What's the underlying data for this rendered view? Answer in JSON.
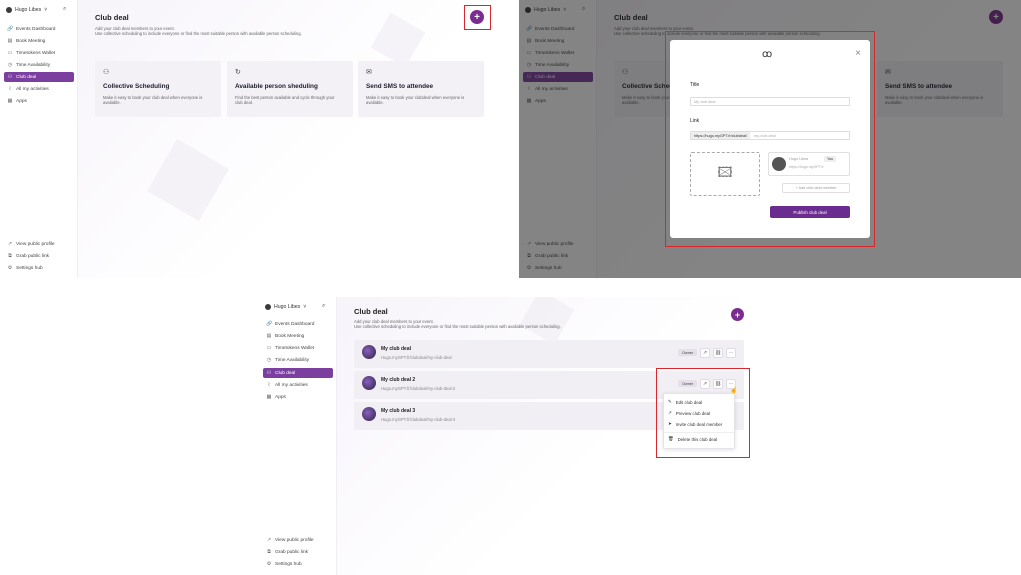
{
  "user": {
    "name": "Hugo Libes",
    "chevron": "˅"
  },
  "sidebar": {
    "items": [
      {
        "label": "Events Dashboard",
        "icon": "link-icon"
      },
      {
        "label": "Book Meeting",
        "icon": "calendar-icon"
      },
      {
        "label": "Timetokens Wallet",
        "icon": "wallet-icon"
      },
      {
        "label": "Time Availability",
        "icon": "clock-icon"
      },
      {
        "label": "Club deal",
        "icon": "users-icon"
      },
      {
        "label": "All my activities",
        "icon": "activity-icon"
      },
      {
        "label": "Apps",
        "icon": "grid-icon"
      }
    ],
    "bottom": [
      {
        "label": "View public profile",
        "icon": "external-icon"
      },
      {
        "label": "Grab public link",
        "icon": "copy-icon"
      },
      {
        "label": "Settings hub",
        "icon": "gear-icon"
      }
    ]
  },
  "page": {
    "title": "Club deal",
    "subtitle1": "Add your club deal members to your event.",
    "subtitle2": "Use collective scheduling to include everyone or find the most suitable person with available person scheduling.",
    "plus": "+"
  },
  "cards": [
    {
      "title": "Collective Scheduling",
      "desc": "Make it easy to book your club deal when everyone is available."
    },
    {
      "title": "Available person sheduling",
      "desc": "Find the best person available and cycle through your club deal."
    },
    {
      "title": "Send SMS to attendee",
      "desc": "Make it easy to book your clubdeal when everyone is available."
    }
  ],
  "modal": {
    "title_label": "Title",
    "title_placeholder": "My club deal",
    "link_label": "Link",
    "link_prefix": "https://hugo.myGPT.fr/clubdeal/",
    "link_placeholder": "my-club-deal",
    "member_name": "Hugo Libes",
    "member_tag": "You",
    "member_url": "https://hugo.myGPT.fr",
    "add_member": "+ Add club deal member",
    "publish": "Publish club deal",
    "close": "×"
  },
  "deals": [
    {
      "title": "My club deal",
      "url": "Hugo.myGPT.fr/clubdeal/my-club-deal",
      "badge": "Owner"
    },
    {
      "title": "My club deal 2",
      "url": "Hugo.myGPT.fr/clubdeal/my-club-deal-2",
      "badge": "Owner"
    },
    {
      "title": "My club deal 3",
      "url": "Hugo.myGPT.fr/clubdeal/my-club-deal-3",
      "badge": ""
    }
  ],
  "menu": {
    "items": [
      {
        "label": "Edit club deal",
        "icon": "pencil-icon"
      },
      {
        "label": "Preview club deal",
        "icon": "external-icon"
      },
      {
        "label": "Invite club deal member",
        "icon": "send-icon"
      },
      {
        "label": "Delete this club deal",
        "icon": "trash-icon"
      }
    ]
  },
  "colors": {
    "accent": "#7b2c8f",
    "highlight": "#d9272e"
  }
}
